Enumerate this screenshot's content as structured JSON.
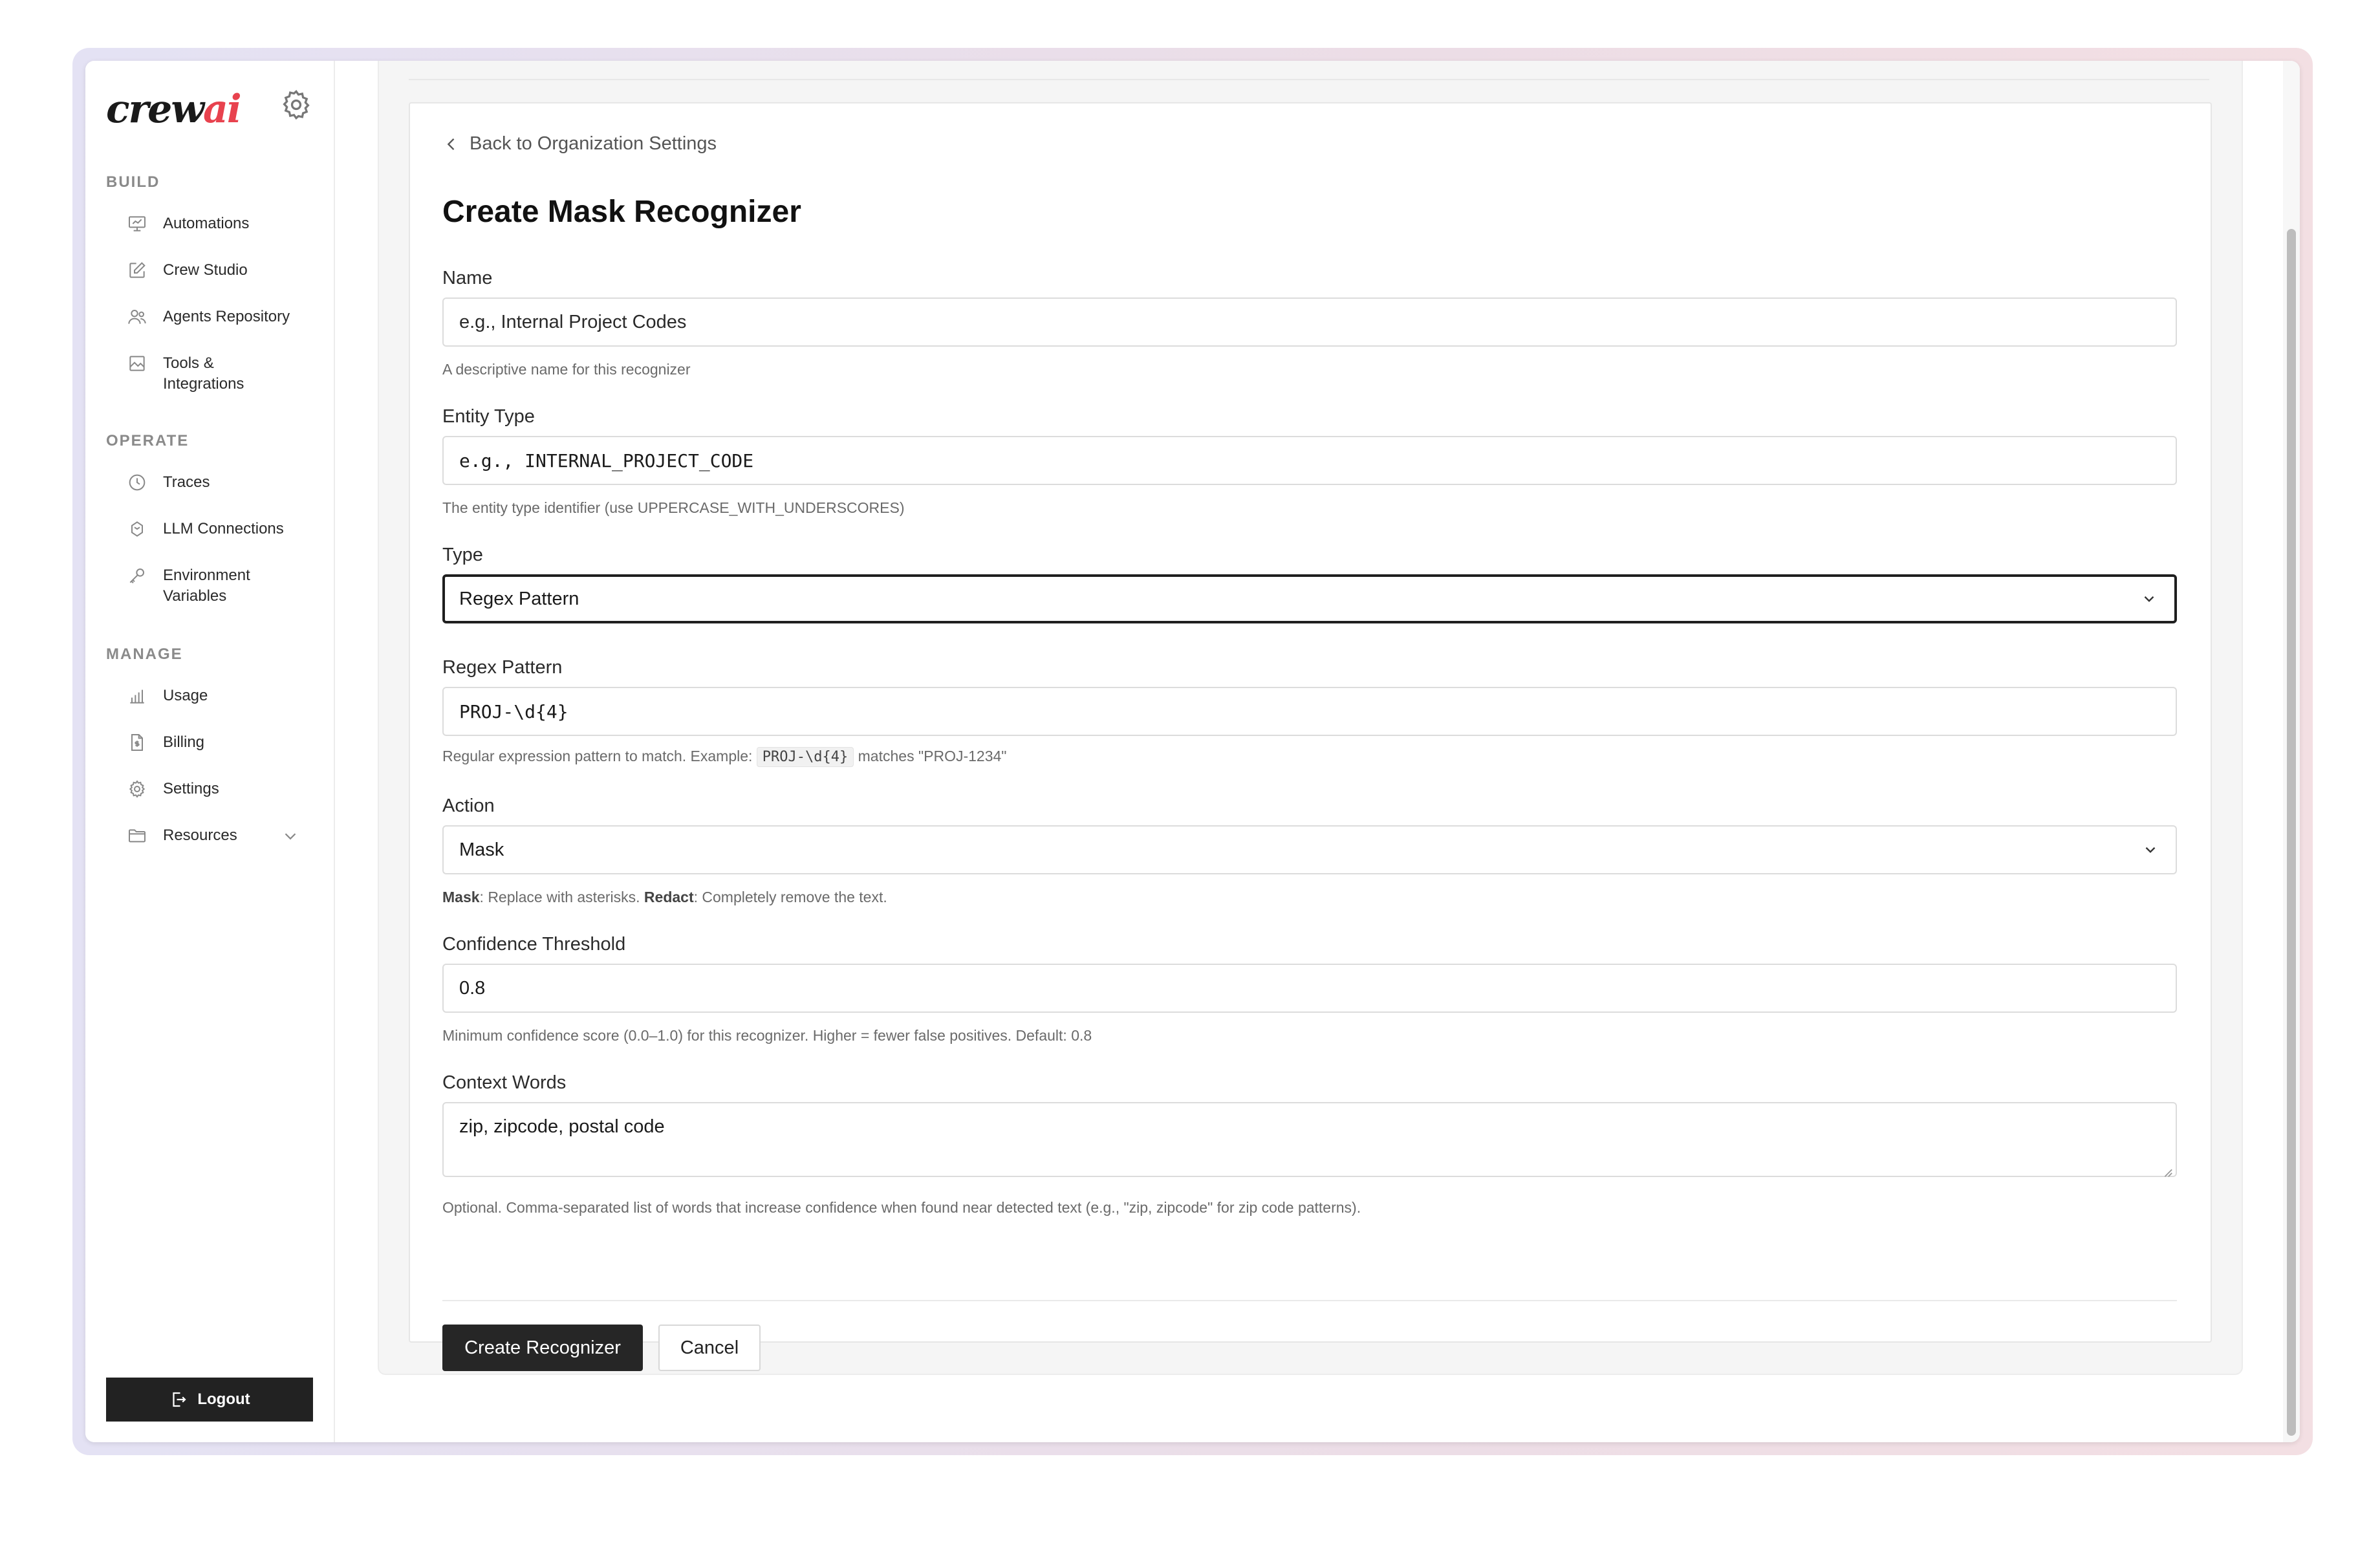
{
  "sidebar": {
    "logo_text": "crew",
    "logo_accent": "ai",
    "sections": [
      {
        "label": "BUILD"
      },
      {
        "label": "OPERATE"
      },
      {
        "label": "MANAGE"
      }
    ],
    "items": [
      {
        "label": "Automations",
        "icon": "presentation-icon"
      },
      {
        "label": "Crew Studio",
        "icon": "pencil-square-icon"
      },
      {
        "label": "Agents Repository",
        "icon": "users-icon"
      },
      {
        "label": "Tools &\nIntegrations",
        "icon": "image-icon"
      },
      {
        "label": "Traces",
        "icon": "clock-icon"
      },
      {
        "label": "LLM Connections",
        "icon": "gem-icon"
      },
      {
        "label": "Environment\nVariables",
        "icon": "key-icon"
      },
      {
        "label": "Usage",
        "icon": "bar-chart-icon"
      },
      {
        "label": "Billing",
        "icon": "file-dollar-icon"
      },
      {
        "label": "Settings",
        "icon": "gear-icon"
      },
      {
        "label": "Resources",
        "icon": "folder-icon"
      }
    ],
    "logout_label": "Logout"
  },
  "form": {
    "back_label": "Back to Organization Settings",
    "title": "Create Mask Recognizer",
    "name": {
      "label": "Name",
      "placeholder": "e.g., Internal Project Codes",
      "help": "A descriptive name for this recognizer"
    },
    "entity_type": {
      "label": "Entity Type",
      "placeholder": "e.g., INTERNAL_PROJECT_CODE",
      "help": "The entity type identifier (use UPPERCASE_WITH_UNDERSCORES)"
    },
    "type": {
      "label": "Type",
      "value": "Regex Pattern"
    },
    "regex": {
      "label": "Regex Pattern",
      "value": "PROJ-\\d{4}",
      "help_prefix": "Regular expression pattern to match. Example:",
      "help_code": "PROJ-\\d{4}",
      "help_suffix": "matches \"PROJ-1234\""
    },
    "action": {
      "label": "Action",
      "value": "Mask",
      "help_mask_term": "Mask",
      "help_mask_desc": ": Replace with asterisks.",
      "help_redact_term": "Redact",
      "help_redact_desc": ": Completely remove the text."
    },
    "confidence": {
      "label": "Confidence Threshold",
      "value": "0.8",
      "help": "Minimum confidence score (0.0–1.0) for this recognizer. Higher = fewer false positives. Default: 0.8"
    },
    "context": {
      "label": "Context Words",
      "value": "zip, zipcode, postal code",
      "help": "Optional. Comma-separated list of words that increase confidence when found near detected text (e.g., \"zip, zipcode\" for zip code patterns)."
    },
    "submit_label": "Create Recognizer",
    "cancel_label": "Cancel"
  },
  "colors": {
    "accent_logo": "#e8424e",
    "primary_button": "#262626"
  }
}
